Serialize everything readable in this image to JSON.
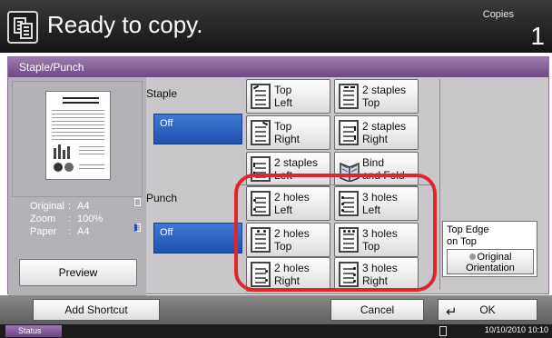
{
  "header": {
    "title": "Ready to copy.",
    "copies_label": "Copies",
    "copies_value": "1"
  },
  "dialog": {
    "tab_title": "Staple/Punch"
  },
  "preview": {
    "info": [
      {
        "label": "Original",
        "value": "A4"
      },
      {
        "label": "Zoom",
        "value": "100%"
      },
      {
        "label": "Paper",
        "value": "A4"
      }
    ],
    "preview_button": "Preview"
  },
  "staple": {
    "label": "Staple",
    "off": "Off",
    "options": {
      "top_left": {
        "line1": "Top",
        "line2": "Left"
      },
      "two_top": {
        "line1": "2 staples",
        "line2": "Top"
      },
      "top_right": {
        "line1": "Top",
        "line2": "Right"
      },
      "two_right": {
        "line1": "2 staples",
        "line2": "Right"
      },
      "two_left": {
        "line1": "2 staples",
        "line2": "Left"
      },
      "bind_fold": {
        "line1": "Bind",
        "line2": "and Fold"
      }
    }
  },
  "punch": {
    "label": "Punch",
    "off": "Off",
    "options": {
      "two_left": {
        "line1": "2 holes",
        "line2": "Left"
      },
      "three_left": {
        "line1": "3 holes",
        "line2": "Left"
      },
      "two_top": {
        "line1": "2 holes",
        "line2": "Top"
      },
      "three_top": {
        "line1": "3 holes",
        "line2": "Top"
      },
      "two_right": {
        "line1": "2 holes",
        "line2": "Right"
      },
      "three_right": {
        "line1": "3 holes",
        "line2": "Right"
      }
    }
  },
  "orientation": {
    "value_line1": "Top Edge",
    "value_line2": "on Top",
    "button_line1": "Original",
    "button_line2": "Orientation"
  },
  "bottom": {
    "add_shortcut": "Add Shortcut",
    "cancel": "Cancel",
    "ok": "OK"
  },
  "status": {
    "label": "Status",
    "datetime": "10/10/2010  10:10"
  },
  "colors": {
    "accent_purple": "#7b5494",
    "selected_blue": "#2a5fc4",
    "highlight_red": "#e0252b"
  }
}
